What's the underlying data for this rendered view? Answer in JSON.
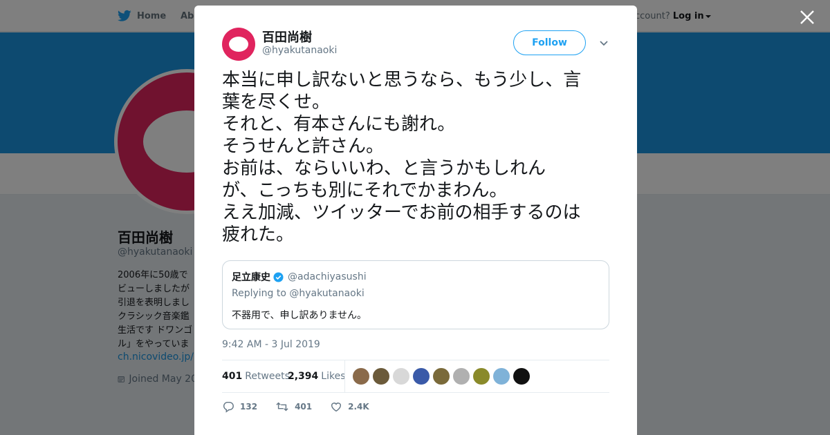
{
  "nav": {
    "home_label": "Home",
    "about_label": "Abo",
    "account_text": "ccount?",
    "login_label": "Log in"
  },
  "profile": {
    "name": "百田尚樹",
    "handle": "@hyakutanaoki",
    "bio_lines": [
      "2006年に50歳で",
      "ビューしましたが",
      "引退を表明しまし",
      "クラシック音楽鑑",
      "生活です ドワンゴ",
      "ル」をやっていま"
    ],
    "link": "ch.nicovideo.jp/hy",
    "joined": "Joined May 20"
  },
  "tweet": {
    "author_name": "百田尚樹",
    "author_handle": "@hyakutanaoki",
    "follow_label": "Follow",
    "text": "本当に申し訳ないと思うなら、もう少し、言\n葉を尽くせ。\nそれと、有本さんにも謝れ。\nそうせんと許さん。\nお前は、ならいいわ、と言うかもしれん\nが、こっちも別にそれでかまわん。\nええ加減、ツイッターでお前の相手するのは\n疲れた。",
    "timestamp": "9:42 AM - 3 Jul 2019",
    "quote": {
      "name": "足立康史",
      "handle": "@adachiyasushi",
      "replying_to": "Replying to @hyakutanaoki",
      "text": "不器用で、申し訳ありません。"
    },
    "stats": {
      "retweets_count": "401",
      "retweets_label": "Retweets",
      "likes_count": "2,394",
      "likes_label": "Likes"
    },
    "actions": {
      "replies": "132",
      "retweets": "401",
      "likes": "2.4K"
    }
  },
  "colors": {
    "accent": "#1da1f2",
    "banner": "#1b95e0",
    "avatar_brand": "#e0245e",
    "verified": "#1da1f2"
  },
  "liker_colors": [
    "#8a6a4a",
    "#6b5a3a",
    "#d8d8d8",
    "#3a5aa8",
    "#7a6a3a",
    "#b0b0b0",
    "#8a8a2a",
    "#7fb2d8",
    "#111111"
  ]
}
